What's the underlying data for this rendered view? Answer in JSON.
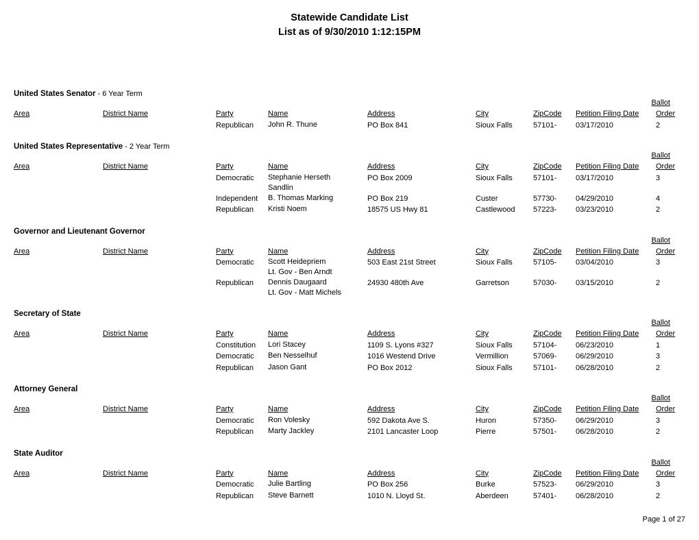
{
  "document": {
    "title_line1": "Statewide Candidate List",
    "title_line2": "List as of 9/30/2010  1:12:15PM",
    "footer": "Page 1 of 27"
  },
  "columns": {
    "area": "Area",
    "district_name": "District Name",
    "party": "Party",
    "name": "Name",
    "address": "Address",
    "city": "City",
    "zipcode": "ZipCode",
    "petition_filing_date": "Petition Filing Date",
    "ballot": "Ballot",
    "order": "Order"
  },
  "sections": [
    {
      "office": "United States Senator",
      "term": " - 6 Year Term",
      "rows": [
        {
          "party": "Republican",
          "name": "John R. Thune",
          "subname": "",
          "address": "PO Box 841",
          "city": "Sioux Falls",
          "zip": "57101-",
          "date": "03/17/2010",
          "order": "2"
        }
      ]
    },
    {
      "office": "United States Representative",
      "term": " - 2 Year Term",
      "rows": [
        {
          "party": "Democratic",
          "name": "Stephanie  Herseth",
          "subname": "Sandlin",
          "address": "PO Box 2009",
          "city": "Sioux Falls",
          "zip": "57101-",
          "date": "03/17/2010",
          "order": "3"
        },
        {
          "party": "Independent",
          "name": "B. Thomas  Marking",
          "subname": "",
          "address": "PO Box 219",
          "city": "Custer",
          "zip": "57730-",
          "date": "04/29/2010",
          "order": "4"
        },
        {
          "party": "Republican",
          "name": "Kristi  Noem",
          "subname": "",
          "address": "18575 US Hwy 81",
          "city": "Castlewood",
          "zip": "57223-",
          "date": "03/23/2010",
          "order": "2"
        }
      ]
    },
    {
      "office": "Governor and Lieutenant Governor",
      "term": "",
      "rows": [
        {
          "party": "Democratic",
          "name": "Scott  Heidepriem",
          "subname": "Lt. Gov - Ben Arndt",
          "address": "503 East 21st Street",
          "city": "Sioux Falls",
          "zip": "57105-",
          "date": "03/04/2010",
          "order": "3"
        },
        {
          "party": "Republican",
          "name": "Dennis  Daugaard",
          "subname": "Lt. Gov - Matt Michels",
          "address": "24930 480th Ave",
          "city": "Garretson",
          "zip": "57030-",
          "date": "03/15/2010",
          "order": "2"
        }
      ]
    },
    {
      "office": "Secretary of State",
      "term": "",
      "rows": [
        {
          "party": "Constitution",
          "name": "Lori  Stacey",
          "subname": "",
          "address": "1109 S. Lyons #327",
          "city": "Sioux Falls",
          "zip": "57104-",
          "date": "06/23/2010",
          "order": "1"
        },
        {
          "party": "Democratic",
          "name": "Ben  Nesselhuf",
          "subname": "",
          "address": "1016 Westend Drive",
          "city": "Vermillion",
          "zip": "57069-",
          "date": "06/29/2010",
          "order": "3"
        },
        {
          "party": "Republican",
          "name": "Jason  Gant",
          "subname": "",
          "address": "PO Box 2012",
          "city": "Sioux Falls",
          "zip": "57101-",
          "date": "06/28/2010",
          "order": "2"
        }
      ]
    },
    {
      "office": "Attorney General",
      "term": "",
      "rows": [
        {
          "party": "Democratic",
          "name": "Ron  Volesky",
          "subname": "",
          "address": "592 Dakota Ave S.",
          "city": "Huron",
          "zip": "57350-",
          "date": "06/29/2010",
          "order": "3"
        },
        {
          "party": "Republican",
          "name": "Marty  Jackley",
          "subname": "",
          "address": "2101 Lancaster Loop",
          "city": "Pierre",
          "zip": "57501-",
          "date": "06/28/2010",
          "order": "2"
        }
      ]
    },
    {
      "office": "State Auditor",
      "term": "",
      "rows": [
        {
          "party": "Democratic",
          "name": "Julie  Bartling",
          "subname": "",
          "address": "PO Box 256",
          "city": "Burke",
          "zip": "57523-",
          "date": "06/29/2010",
          "order": "3"
        },
        {
          "party": "Republican",
          "name": "Steve  Barnett",
          "subname": "",
          "address": "1010 N. Lloyd St.",
          "city": "Aberdeen",
          "zip": "57401-",
          "date": "06/28/2010",
          "order": "2"
        }
      ]
    }
  ]
}
